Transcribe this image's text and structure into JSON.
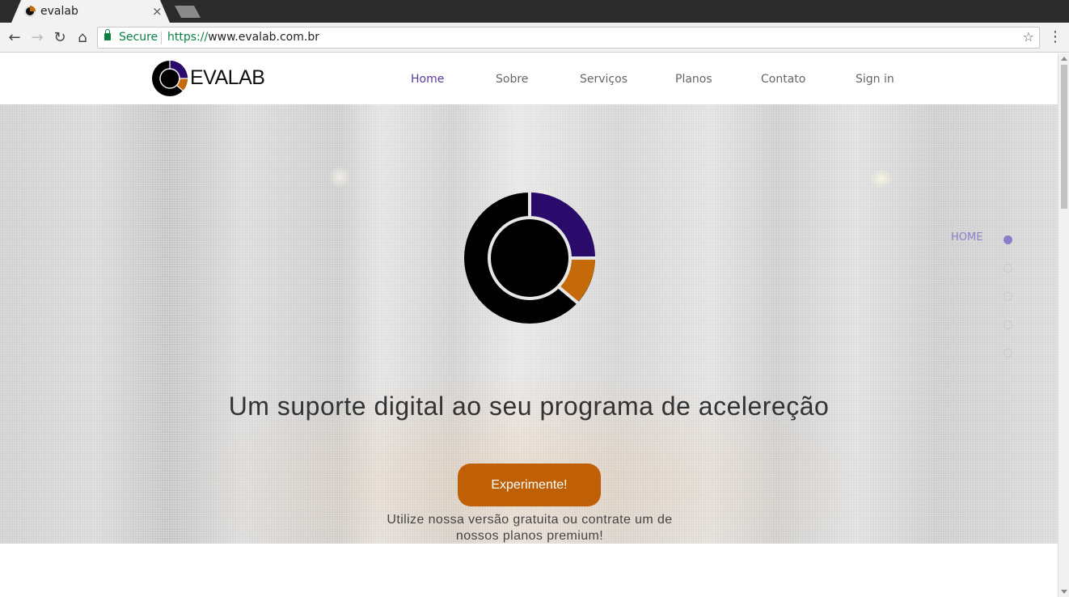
{
  "browser": {
    "tab_title": "evalab",
    "tab_close": "×",
    "secure_label": "Secure",
    "url_scheme": "https://",
    "url_rest": "www.evalab.com.br",
    "icons": [
      "back-icon",
      "forward-icon",
      "reload-icon",
      "home-icon",
      "lock-icon",
      "star-icon",
      "menu-icon"
    ]
  },
  "site": {
    "logo_text": "EVALAB",
    "nav": [
      {
        "label": "Home",
        "active": true
      },
      {
        "label": "Sobre",
        "active": false
      },
      {
        "label": "Serviços",
        "active": false
      },
      {
        "label": "Planos",
        "active": false
      },
      {
        "label": "Contato",
        "active": false
      },
      {
        "label": "Sign in",
        "active": false
      }
    ]
  },
  "hero": {
    "title": "Um suporte digital ao seu programa de acelereção",
    "cta_label": "Experimente!",
    "subtitle": "Utilize nossa versão gratuita ou contrate um de nossos planos premium!"
  },
  "side_nav": {
    "active_label": "HOME",
    "dot_count": 5,
    "active_index": 0
  },
  "colors": {
    "brand_purple": "#2a0a6b",
    "brand_orange": "#c46a08",
    "cta": "#bf6006",
    "nav_active": "#5a3a9a",
    "dot_active": "#8a80c8"
  }
}
